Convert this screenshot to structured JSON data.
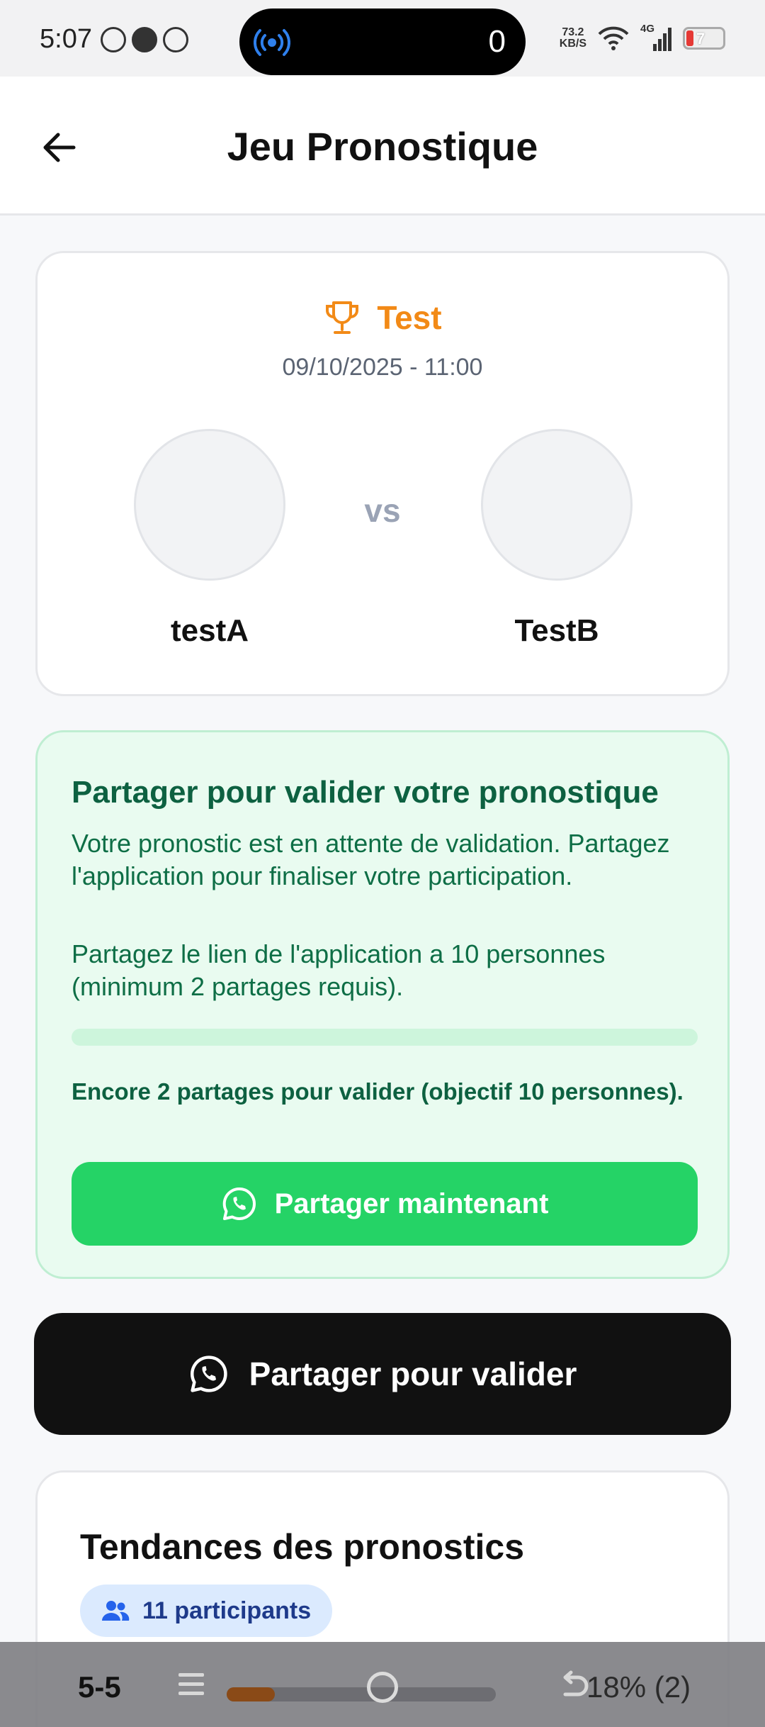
{
  "status_bar": {
    "time": "5:07",
    "island_count": "0",
    "net_speed_value": "73.2",
    "net_speed_unit": "KB/S",
    "network": "4G",
    "battery": "7"
  },
  "header": {
    "title": "Jeu Pronostique"
  },
  "match": {
    "competition": "Test",
    "datetime": "09/10/2025 - 11:00",
    "team_a": "testA",
    "team_b": "TestB",
    "vs": "vs"
  },
  "share_card": {
    "title": "Partager pour valider votre pronostique",
    "text1": "Votre pronostic est en attente de validation. Partagez l'application pour finaliser votre participation.",
    "text2": "Partagez le lien de l'application a 10 personnes (minimum 2 partages requis).",
    "progress_fraction": 0,
    "remaining": "Encore 2 partages pour valider (objectif 10 personnes).",
    "button": "Partager maintenant"
  },
  "validate_button": "Partager pour valider",
  "trends": {
    "title": "Tendances des pronostics",
    "participants": "11 participants"
  },
  "reader_overlay": {
    "page": "5-5",
    "percent": "18% (2)",
    "progress_fraction": 0.18
  },
  "colors": {
    "accent_orange": "#f28a17",
    "whatsapp_green": "#25d366",
    "share_bg": "#e9fbf0",
    "dark_button": "#111111",
    "pill_bg": "#dbeafe"
  }
}
